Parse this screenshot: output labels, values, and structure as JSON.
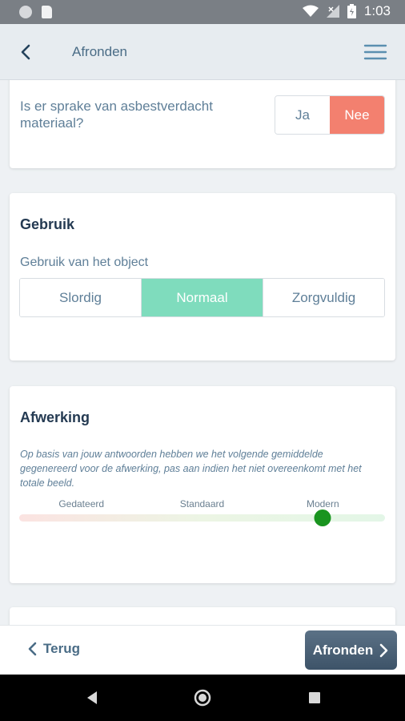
{
  "status_bar": {
    "time": "1:03"
  },
  "app_bar": {
    "title": "Afronden"
  },
  "asbest_card": {
    "question": "Is er sprake van asbestverdacht materiaal?",
    "options": [
      "Ja",
      "Nee"
    ],
    "selected": "Nee"
  },
  "gebruik_card": {
    "title": "Gebruik",
    "label": "Gebruik van het object",
    "options": [
      "Slordig",
      "Normaal",
      "Zorgvuldig"
    ],
    "selected": "Normaal"
  },
  "afwerking_card": {
    "title": "Afwerking",
    "description": "Op basis van jouw antwoorden hebben we het volgende gemiddelde gegenereerd voor de afwerking, pas aan indien het niet overeenkomt met het totale beeld.",
    "scale_labels": [
      "Gedateerd",
      "Standaard",
      "Modern"
    ],
    "slider_value": 0.83
  },
  "bottom_bar": {
    "back_label": "Terug",
    "finish_label": "Afronden"
  },
  "colors": {
    "accent_selected_no": "#f3806f",
    "accent_selected_segment": "#7fdcbd",
    "slider_thumb": "#19941f",
    "primary_button": "#4a5f74"
  }
}
